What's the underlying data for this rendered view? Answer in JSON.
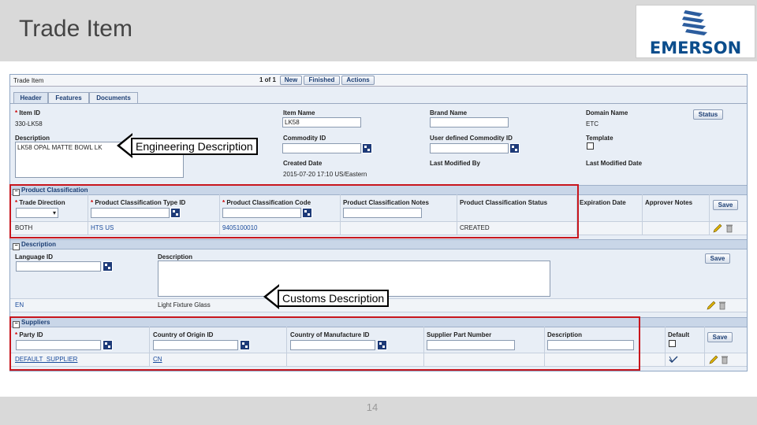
{
  "slide": {
    "title": "Trade Item",
    "logo_text": "EMERSON",
    "page_number": "14"
  },
  "app": {
    "window_title": "Trade Item",
    "pager": "1 of 1",
    "buttons": {
      "new": "New",
      "finished": "Finished",
      "actions": "Actions"
    },
    "tabs": [
      "Header",
      "Features",
      "Documents"
    ],
    "header": {
      "item_id_label": "Item ID",
      "item_id_value": "330-LK58",
      "item_name_label": "Item Name",
      "item_name_value": "LK58",
      "brand_name_label": "Brand Name",
      "domain_name_label": "Domain Name",
      "domain_name_value": "ETC",
      "status_button": "Status",
      "description_label": "Description",
      "description_value": "LK58 OPAL MATTE BOWL LK",
      "commodity_id_label": "Commodity ID",
      "user_commodity_label": "User defined Commodity ID",
      "template_label": "Template",
      "created_date_label": "Created Date",
      "created_date_value": "2015-07-20 17:10 US/Eastern",
      "last_modified_by_label": "Last Modified By",
      "last_modified_date_label": "Last Modified Date"
    },
    "product_classification": {
      "section_title": "Product Classification",
      "columns": [
        "Trade Direction",
        "Product Classification Type ID",
        "Product Classification Code",
        "Product Classification Notes",
        "Product Classification Status",
        "Expiration Date",
        "Approver Notes"
      ],
      "save_label": "Save",
      "row": {
        "trade_direction": "BOTH",
        "type_id": "HTS US",
        "code": "9405100010",
        "status": "CREATED"
      }
    },
    "description_section": {
      "section_title": "Description",
      "language_label": "Language ID",
      "description_label": "Description",
      "save_label": "Save",
      "row": {
        "language": "EN",
        "description": "Light Fixture Glass"
      }
    },
    "suppliers": {
      "section_title": "Suppliers",
      "columns": [
        "Party ID",
        "Country of Origin ID",
        "Country of Manufacture ID",
        "Supplier Part Number",
        "Description",
        "Default"
      ],
      "save_label": "Save",
      "row": {
        "party_id": "DEFAULT_SUPPLIER",
        "country_origin": "CN"
      }
    }
  },
  "callouts": {
    "engineering": "Engineering Description",
    "customs": "Customs Description"
  },
  "colors": {
    "highlight": "#c8161d",
    "brand": "#0b4d8c",
    "section_bar": "#c9d6e8"
  }
}
